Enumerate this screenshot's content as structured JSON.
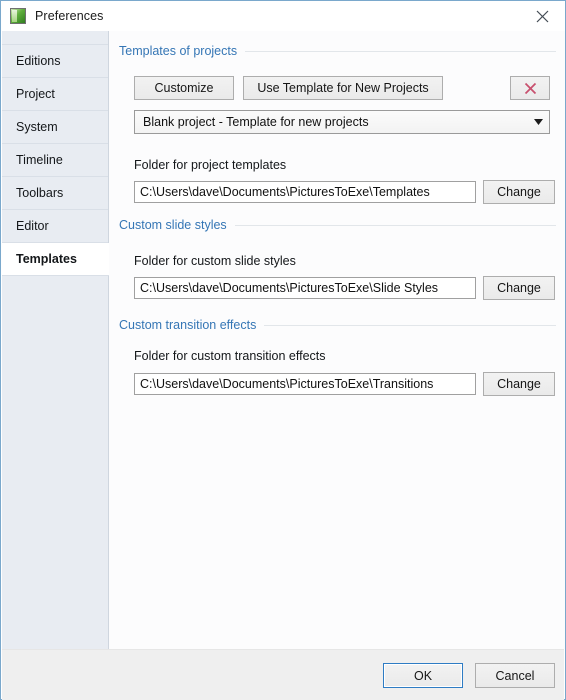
{
  "window": {
    "title": "Preferences",
    "app_icon": "pictures-to-exe-icon",
    "close_icon": "close-icon",
    "border_color": "#7aa8cc"
  },
  "sidebar": {
    "items": [
      {
        "label": "Editions",
        "selected": false
      },
      {
        "label": "Project",
        "selected": false
      },
      {
        "label": "System",
        "selected": false
      },
      {
        "label": "Timeline",
        "selected": false
      },
      {
        "label": "Toolbars",
        "selected": false
      },
      {
        "label": "Editor",
        "selected": false
      },
      {
        "label": "Templates",
        "selected": true
      }
    ]
  },
  "sections": {
    "templates_of_projects": {
      "heading": "Templates of projects",
      "heading_color": "#3576b5",
      "customize_label": "Customize",
      "use_template_label": "Use Template for New Projects",
      "delete_icon": "red-x-delete-icon",
      "delete_icon_color": "#c8506e",
      "combo_value": "Blank project - Template for new projects",
      "combo_arrow_icon": "chevron-down-icon",
      "folder_label": "Folder for project templates",
      "folder_path": "C:\\Users\\dave\\Documents\\PicturesToExe\\Templates",
      "change_label": "Change"
    },
    "custom_slide_styles": {
      "heading": "Custom slide styles",
      "heading_color": "#3576b5",
      "folder_label": "Folder for custom slide styles",
      "folder_path": "C:\\Users\\dave\\Documents\\PicturesToExe\\Slide Styles",
      "change_label": "Change"
    },
    "custom_transition_effects": {
      "heading": "Custom transition effects",
      "heading_color": "#3576b5",
      "folder_label": "Folder for custom transition effects",
      "folder_path": "C:\\Users\\dave\\Documents\\PicturesToExe\\Transitions",
      "change_label": "Change"
    }
  },
  "footer": {
    "ok_label": "OK",
    "cancel_label": "Cancel",
    "focus_color": "#2e7cc4"
  }
}
